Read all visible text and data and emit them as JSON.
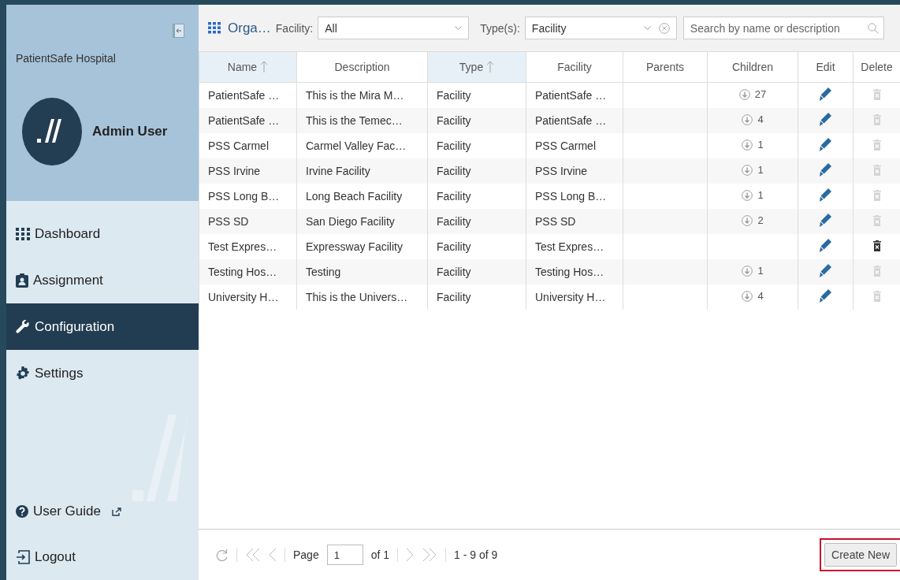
{
  "sidebar": {
    "organization": "PatientSafe Hospital",
    "user": "Admin User",
    "nav": [
      {
        "label": "Dashboard",
        "selected": false
      },
      {
        "label": "Assignment",
        "selected": false
      },
      {
        "label": "Configuration",
        "selected": true
      },
      {
        "label": "Settings",
        "selected": false
      }
    ],
    "bottom": [
      {
        "label": "User Guide",
        "external": true
      },
      {
        "label": "Logout",
        "external": false
      }
    ]
  },
  "toolbar": {
    "title": "Orga…",
    "facility_label": "Facility:",
    "facility_value": "All",
    "type_label": "Type(s):",
    "type_value": "Facility",
    "search_placeholder": "Search by name or description"
  },
  "table": {
    "columns": [
      {
        "label": "Name",
        "sorted": true
      },
      {
        "label": "Description",
        "sorted": false
      },
      {
        "label": "Type",
        "sorted": true
      },
      {
        "label": "Facility",
        "sorted": false
      },
      {
        "label": "Parents",
        "sorted": false
      },
      {
        "label": "Children",
        "sorted": false
      },
      {
        "label": "Edit",
        "sorted": false
      },
      {
        "label": "Delete",
        "sorted": false
      }
    ],
    "rows": [
      {
        "name": "PatientSafe …",
        "description": "This is the Mira M…",
        "type": "Facility",
        "facility": "PatientSafe …",
        "children": "27",
        "deletable": false
      },
      {
        "name": "PatientSafe …",
        "description": "This is the Temec…",
        "type": "Facility",
        "facility": "PatientSafe …",
        "children": "4",
        "deletable": false
      },
      {
        "name": "PSS Carmel",
        "description": "Carmel Valley Fac…",
        "type": "Facility",
        "facility": "PSS Carmel",
        "children": "1",
        "deletable": false
      },
      {
        "name": "PSS Irvine",
        "description": "Irvine Facility",
        "type": "Facility",
        "facility": "PSS Irvine",
        "children": "1",
        "deletable": false
      },
      {
        "name": "PSS Long B…",
        "description": "Long Beach Facility",
        "type": "Facility",
        "facility": "PSS Long B…",
        "children": "1",
        "deletable": false
      },
      {
        "name": "PSS SD",
        "description": "San Diego Facility",
        "type": "Facility",
        "facility": "PSS SD",
        "children": "2",
        "deletable": false
      },
      {
        "name": "Test Expres…",
        "description": "Expressway Facility",
        "type": "Facility",
        "facility": "Test Expres…",
        "deletable": true
      },
      {
        "name": "Testing Hos…",
        "description": "Testing",
        "type": "Facility",
        "facility": "Testing Hos…",
        "children": "1",
        "deletable": false
      },
      {
        "name": "University H…",
        "description": "This is the Univers…",
        "type": "Facility",
        "facility": "University H…",
        "children": "4",
        "deletable": false
      }
    ]
  },
  "pager": {
    "page_label": "Page",
    "page": "1",
    "of": "of 1",
    "range": "1 - 9 of 9"
  },
  "create_button": {
    "label": "Create New",
    "highlighted": true
  }
}
